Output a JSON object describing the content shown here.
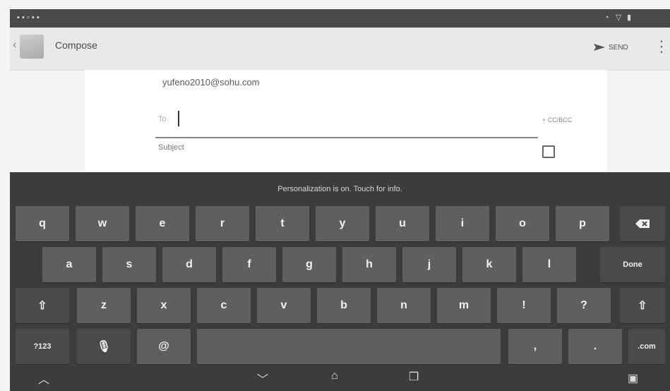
{
  "header": {
    "title": "Compose",
    "send_label": "SEND"
  },
  "compose": {
    "from": "yufeno2010@sohu.com",
    "to_label": "To",
    "to_value": "",
    "cc_bcc_label": "+ CC/BCC",
    "subject_placeholder": "Subject"
  },
  "keyboard": {
    "hint": "Personalization is on. Touch for info.",
    "rows": [
      [
        "q",
        "w",
        "e",
        "r",
        "t",
        "y",
        "u",
        "i",
        "o",
        "p"
      ],
      [
        "a",
        "s",
        "d",
        "f",
        "g",
        "h",
        "j",
        "k",
        "l"
      ],
      [
        "z",
        "x",
        "c",
        "v",
        "b",
        "n",
        "m",
        "!",
        "?"
      ]
    ],
    "done_label": "Done",
    "symbols_label": "?123",
    "at_label": "@",
    "comma_label": ",",
    "period_label": ".",
    "com_label": ".com",
    "backspace_icon": "backspace-icon",
    "shift_icon": "shift-icon",
    "mic_icon": "microphone-icon"
  },
  "colors": {
    "keyboard_bg": "#3c3c3c",
    "key_bg": "#5f5f5f",
    "statusbar_bg": "#4a4a4a"
  }
}
